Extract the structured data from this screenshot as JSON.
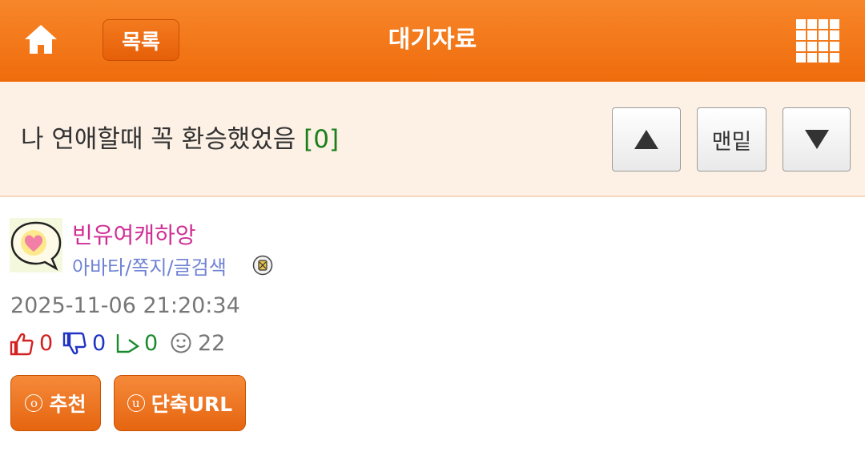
{
  "header": {
    "list_label": "목록",
    "title": "대기자료",
    "home_icon": "home-icon",
    "menu_icon": "grid-menu-icon",
    "color": "#f07a1c"
  },
  "post": {
    "title": "나 연애할때 꼭 환승했었음",
    "reply_count": "[0]",
    "nav": {
      "up_icon": "triangle-up-icon",
      "bottom_label": "맨밑",
      "down_icon": "triangle-down-icon"
    }
  },
  "author": {
    "nickname": "빈유여캐하앙",
    "avatar_link": "아바타/쪽지/글검색",
    "avatar_icon": "heart-speech-bubble-icon",
    "badge_icon": "level-badge-icon"
  },
  "meta": {
    "date": "2025-11-06 21:20:34",
    "likes": "0",
    "dislikes": "0",
    "shares": "0",
    "views": "22"
  },
  "actions": {
    "recommend_key": "o",
    "recommend_label": "추천",
    "shorturl_key": "u",
    "shorturl_label": "단축URL"
  }
}
